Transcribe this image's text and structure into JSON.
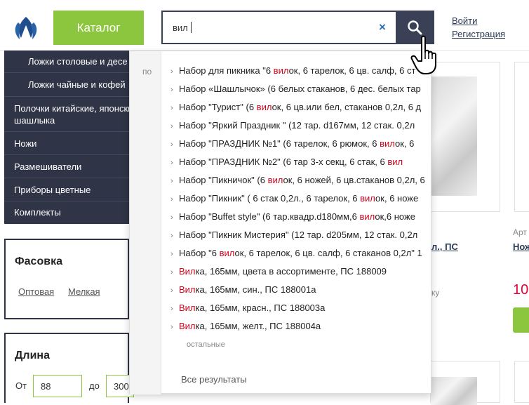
{
  "header": {
    "catalog_label": "Каталог",
    "search_value": "вил",
    "clear_symbol": "×",
    "login_label": "Войти",
    "register_label": "Регистрация"
  },
  "sidebar": {
    "items": [
      {
        "label": "Ложки столовые и десе",
        "level": "sub"
      },
      {
        "label": "Ложки чайные и кофей",
        "level": "sub"
      },
      {
        "label": "Полочки китайские, японски",
        "label2": "шашлыка",
        "level": "top"
      },
      {
        "label": "Ножи",
        "level": "top"
      },
      {
        "label": "Размешиватели",
        "level": "top"
      },
      {
        "label": "Приборы цветные",
        "level": "top"
      },
      {
        "label": "Комплекты",
        "level": "top"
      }
    ]
  },
  "filters": {
    "packing": {
      "title": "Фасовка",
      "options": [
        "Оптовая",
        "Мелкая"
      ]
    },
    "length": {
      "title": "Длина",
      "from_label": "От",
      "from_value": "88",
      "to_label": "до",
      "to_value": "300"
    }
  },
  "suggestions": {
    "prefix": "по",
    "items": [
      {
        "before": "Набор для пикника \"6 ",
        "hl": "вил",
        "after": "ок, 6 тарелок, 6 цв. салф, 6 ст"
      },
      {
        "before": "Набор «Шашлычок» (6 белых стаканов, 6 дес. белых тар",
        "hl": "",
        "after": ""
      },
      {
        "before": "Набор \"Турист\" (6 ",
        "hl": "вил",
        "after": "ок, 6 цв.или бел, стаканов 0,2л, 6 д"
      },
      {
        "before": "Набор \"Яркий Праздник \" (12 тар. d167мм, 12 стак. 0,2л ",
        "hl": "",
        "after": ""
      },
      {
        "before": "Набор \"ПРАЗДНИК №1\" (6 тарелок, 6 рюмок, 6 ",
        "hl": "вил",
        "after": "ок, 6"
      },
      {
        "before": "Набор \"ПРАЗДНИК №2\" (6 тар 3-х секц, 6 стак, 6 ",
        "hl": "вил",
        "after": ""
      },
      {
        "before": "Набор \"Пикничок\" (6 ",
        "hl": "вил",
        "after": "ок, 6 ножей, 6 цв.стаканов 0,2л, 6"
      },
      {
        "before": "Набор \"Пикник\" ( 6 стак 0,2л., 6 тарелок, 6 ",
        "hl": "вил",
        "after": "ок, 6 ноже"
      },
      {
        "before": "Набор \"Buffet style\" (6 тар.квадр.d180мм,6 ",
        "hl": "вил",
        "after": "ок,6 ноже"
      },
      {
        "before": "Набор \"Пикник Мистерия\" (12 тар. d205мм, 12 стак. 0,2л",
        "hl": "",
        "after": ""
      },
      {
        "before": "Набор \"6 ",
        "hl": "вил",
        "after": "ок, 6 тарелок, 6 цв. салф, 6 стаканов 0,2л\" 1"
      },
      {
        "before": "",
        "hl": "Вил",
        "after": "ка, 165мм, цвета в ассортименте, ПС 188009"
      },
      {
        "before": "",
        "hl": "Вил",
        "after": "ка, 165мм, син., ПС 188001а"
      },
      {
        "before": "",
        "hl": "Вил",
        "after": "ка, 165мм, красн., ПС 188003а"
      },
      {
        "before": "",
        "hl": "Вил",
        "after": "ка, 165мм, желт., ПС 188004а"
      }
    ],
    "more_label": "остальные",
    "all_results_label": "Все результаты"
  },
  "background": {
    "article_prefix": "Арт",
    "product_link_fragment": "Нож",
    "product_link_fragment2": "л., ПС",
    "price_fragment": "10",
    "note_fragment": "ку"
  },
  "colors": {
    "brand_dark": "#2f3446",
    "accent_green": "#8cc63f",
    "highlight_red": "#d0021b",
    "price_red": "#e4003a"
  }
}
